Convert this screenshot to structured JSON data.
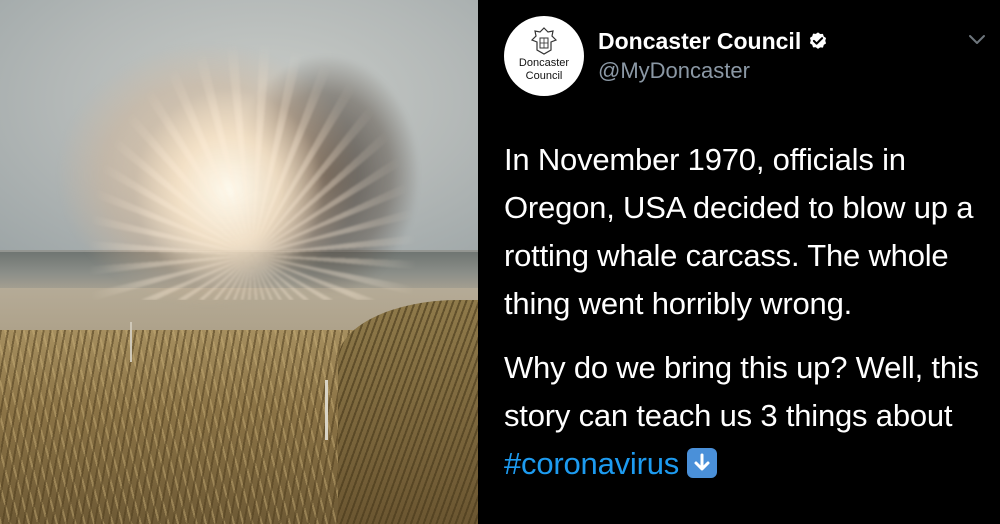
{
  "tweet": {
    "display_name": "Doncaster Council",
    "handle": "@MyDoncaster",
    "avatar_text_line1": "Doncaster",
    "avatar_text_line2": "Council",
    "paragraph1": "In November 1970, officials in Oregon, USA decided to blow up a rotting whale carcass. The whole thing went horribly wrong.",
    "paragraph2_prefix": "Why do we bring this up? Well, this story can teach us 3 things about ",
    "hashtag": "#coronavirus",
    "emoji": "down-arrow-emoji"
  },
  "icons": {
    "verified": "verified-badge-icon",
    "menu": "chevron-down-icon"
  },
  "colors": {
    "background": "#000000",
    "text": "#ffffff",
    "handle": "#8b98a5",
    "link": "#1d9bf0",
    "emoji_bg": "#4a90d9"
  }
}
